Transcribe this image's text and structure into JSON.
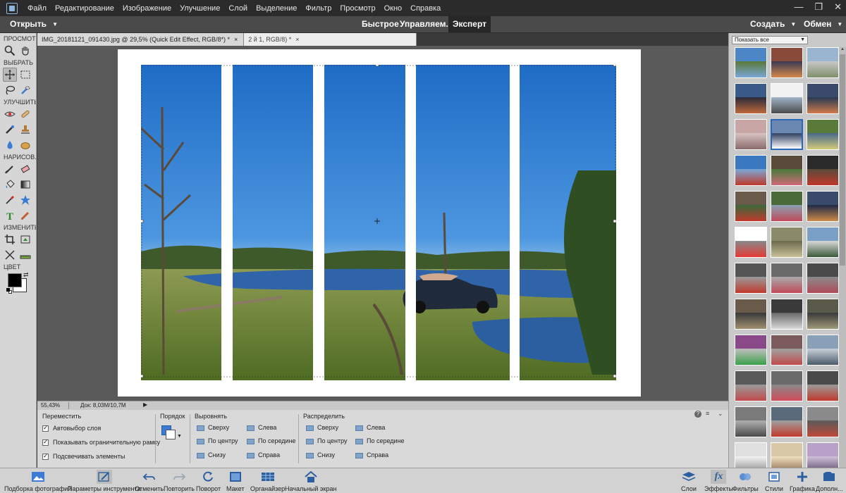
{
  "menu": {
    "items": [
      "Файл",
      "Редактирование",
      "Изображение",
      "Улучшение",
      "Слой",
      "Выделение",
      "Фильтр",
      "Просмотр",
      "Окно",
      "Справка"
    ]
  },
  "modebar": {
    "open_label": "Открыть",
    "modes": [
      "Быстрое",
      "Управляем.",
      "Эксперт"
    ],
    "selected_mode": "Эксперт",
    "create_label": "Создать",
    "share_label": "Обмен"
  },
  "toolbar": {
    "sections": {
      "view": "ПРОСМОТР",
      "select": "ВЫБРАТЬ",
      "enhance": "УЛУЧШИТЬ",
      "draw": "НАРИСОВ...",
      "modify": "ИЗМЕНИТЬ",
      "color": "ЦВЕТ"
    },
    "foreground_color": "#000000",
    "background_color": "#ffffff"
  },
  "tabs": [
    {
      "label": "IMG_20181121_091430.jpg @ 29,5% (Quick Edit Effect, RGB/8*) *",
      "close": "×"
    },
    {
      "label": "2                          й 1, RGB/8) *",
      "close": "×"
    }
  ],
  "status": {
    "zoom": "55,43%",
    "doc_size": "Док: 8,03M/10,7M",
    "arrow": "▶"
  },
  "options": {
    "move_title": "Переместить",
    "checkboxes": [
      "Автовыбор слоя",
      "Показывать ограничительную рамку",
      "Подсвечивать элементы"
    ],
    "order_title": "Порядок",
    "align_title": "Выровнять",
    "align": [
      "Сверху",
      "Слева",
      "По центру",
      "По середине",
      "Снизу",
      "Справа"
    ],
    "distribute_title": "Распределить",
    "distribute": [
      "Сверху",
      "Слева",
      "По центру",
      "По середине",
      "Снизу",
      "Справа"
    ],
    "help": "?"
  },
  "bottombar": {
    "left": [
      "Подборка фотографий",
      "Параметры инструмента",
      "Отменить",
      "Повторить",
      "Поворот",
      "Макет",
      "Органайзер",
      "Начальный экран"
    ],
    "right": [
      "Слои",
      "Эффекты",
      "Фильтры",
      "Стили",
      "Графика",
      "Дополн..."
    ]
  },
  "rightpanel": {
    "filter_label": "Показать все",
    "filter_caret": "▼"
  },
  "colors": {
    "accent": "#2b67b8",
    "menubar": "#2b2b2b",
    "panel": "#d6d6d6"
  }
}
